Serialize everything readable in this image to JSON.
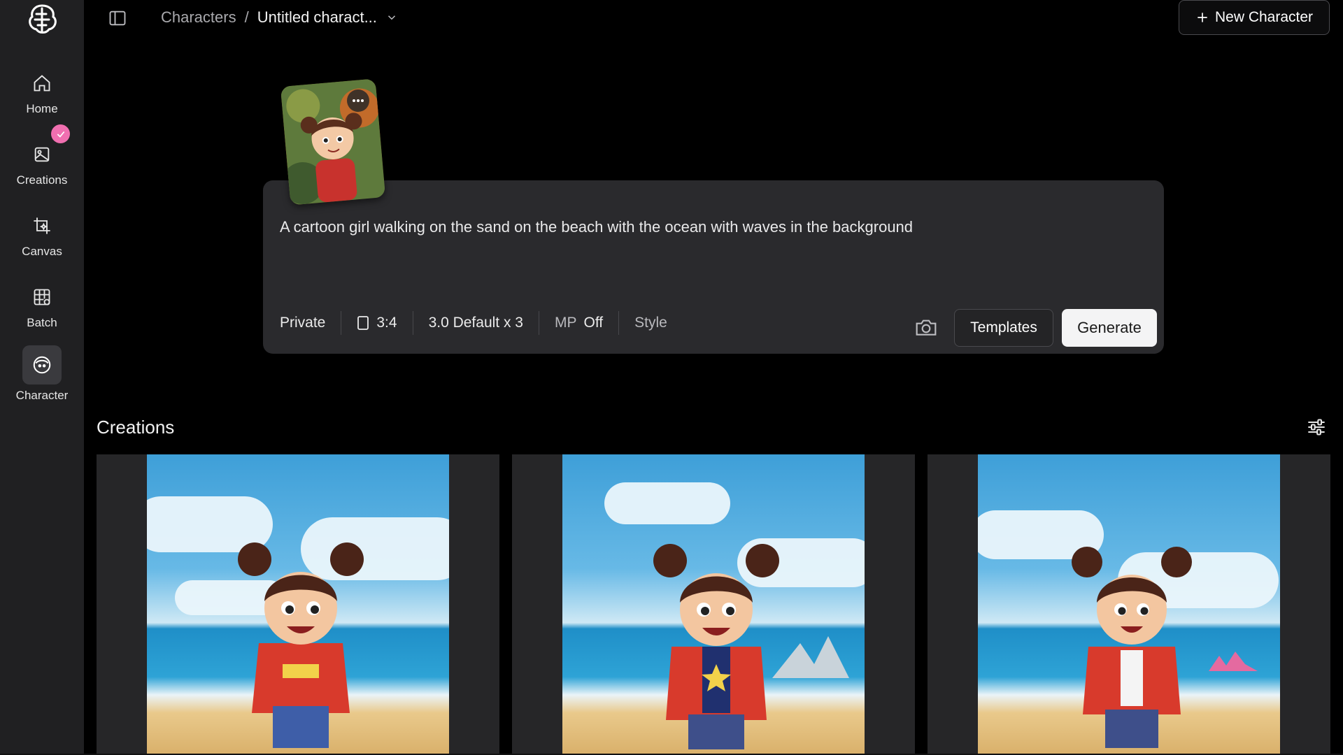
{
  "sidebar": {
    "items": [
      {
        "label": "Home",
        "icon": "home-icon"
      },
      {
        "label": "Creations",
        "icon": "image-icon"
      },
      {
        "label": "Canvas",
        "icon": "canvas-icon"
      },
      {
        "label": "Batch",
        "icon": "batch-icon"
      },
      {
        "label": "Character",
        "icon": "character-icon"
      }
    ],
    "active": "Character",
    "badge_color": "#f06fb0"
  },
  "header": {
    "breadcrumb_root": "Characters",
    "breadcrumb_sep": "/",
    "breadcrumb_current": "Untitled charact...",
    "new_character_label": "New Character"
  },
  "prompt": {
    "text": "A cartoon girl walking on the sand on the beach with the ocean with waves in the background",
    "visibility": "Private",
    "aspect_ratio": "3:4",
    "model": "3.0 Default x 3",
    "mp_label": "MP",
    "mp_value": "Off",
    "style_label": "Style",
    "templates_label": "Templates",
    "generate_label": "Generate"
  },
  "creations": {
    "title": "Creations",
    "images": [
      {
        "alt": "cartoon girl on beach 1"
      },
      {
        "alt": "cartoon girl on beach 2"
      },
      {
        "alt": "cartoon girl on beach 3"
      }
    ]
  }
}
